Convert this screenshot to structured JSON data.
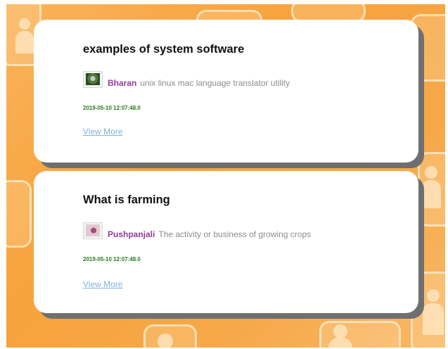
{
  "posts": [
    {
      "title": "examples of system software",
      "author": "Bharan",
      "description": "unix linux mac language translator utility",
      "timestamp": "2019-05-10 12:07:48.0",
      "link_label": "View More",
      "avatar_icon": "user-photo-icon"
    },
    {
      "title": "What is farming",
      "author": "Pushpanjali",
      "description": "The activity or business of growing crops",
      "timestamp": "2019-05-10 12:07:48.0",
      "link_label": "View More",
      "avatar_icon": "user-photo-icon"
    }
  ],
  "colors": {
    "background": "#f7a23c",
    "card": "#ffffff",
    "card_shadow": "#6f6f6f",
    "author": "#8e3f97",
    "description": "#8c8c8c",
    "timestamp": "#2a7a1e",
    "link": "#7fb3df"
  }
}
